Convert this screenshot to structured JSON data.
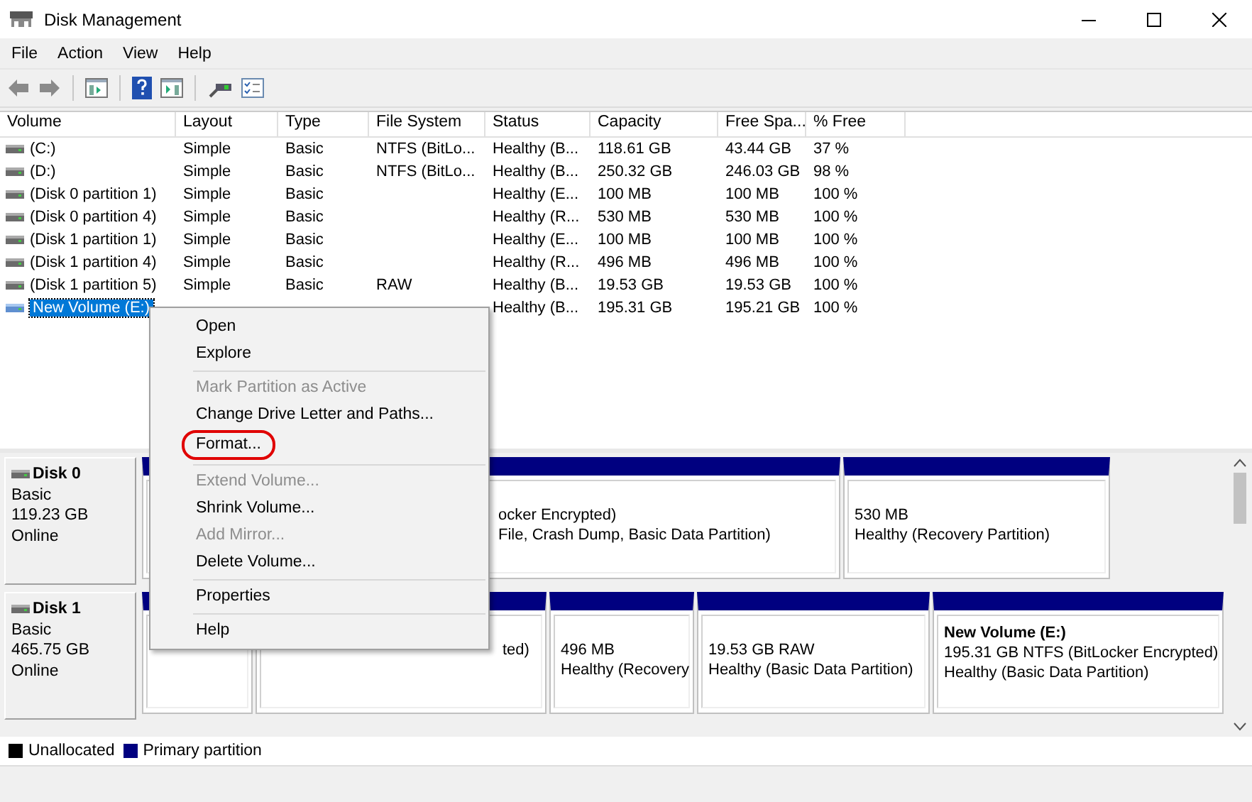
{
  "window": {
    "title": "Disk Management"
  },
  "menu_bar": [
    "File",
    "Action",
    "View",
    "Help"
  ],
  "table": {
    "columns": [
      "Volume",
      "Layout",
      "Type",
      "File System",
      "Status",
      "Capacity",
      "Free Spa...",
      "% Free"
    ],
    "rows": [
      {
        "cells": [
          "(C:)",
          "Simple",
          "Basic",
          "NTFS (BitLo...",
          "Healthy (B...",
          "118.61 GB",
          "43.44 GB",
          "37 %"
        ],
        "selected": false
      },
      {
        "cells": [
          "(D:)",
          "Simple",
          "Basic",
          "NTFS (BitLo...",
          "Healthy (B...",
          "250.32 GB",
          "246.03 GB",
          "98 %"
        ],
        "selected": false
      },
      {
        "cells": [
          "(Disk 0 partition 1)",
          "Simple",
          "Basic",
          "",
          "Healthy (E...",
          "100 MB",
          "100 MB",
          "100 %"
        ],
        "selected": false
      },
      {
        "cells": [
          "(Disk 0 partition 4)",
          "Simple",
          "Basic",
          "",
          "Healthy (R...",
          "530 MB",
          "530 MB",
          "100 %"
        ],
        "selected": false
      },
      {
        "cells": [
          "(Disk 1 partition 1)",
          "Simple",
          "Basic",
          "",
          "Healthy (E...",
          "100 MB",
          "100 MB",
          "100 %"
        ],
        "selected": false
      },
      {
        "cells": [
          "(Disk 1 partition 4)",
          "Simple",
          "Basic",
          "",
          "Healthy (R...",
          "496 MB",
          "496 MB",
          "100 %"
        ],
        "selected": false
      },
      {
        "cells": [
          "(Disk 1 partition 5)",
          "Simple",
          "Basic",
          "RAW",
          "Healthy (B...",
          "19.53 GB",
          "19.53 GB",
          "100 %"
        ],
        "selected": false
      },
      {
        "cells": [
          "New Volume (E:)",
          "",
          "",
          "",
          "Healthy (B...",
          "195.31 GB",
          "195.21 GB",
          "100 %"
        ],
        "selected": true
      }
    ]
  },
  "disks": [
    {
      "name": "Disk 0",
      "type": "Basic",
      "size": "119.23 GB",
      "status": "Online",
      "partitions": [
        {
          "kind": "hidden"
        },
        {
          "kind": "covered",
          "lines": [
            "ocker Encrypted)",
            "File, Crash Dump, Basic Data Partition)"
          ]
        },
        {
          "kind": "plain",
          "lines": [
            "530 MB",
            "Healthy (Recovery Partition)"
          ]
        }
      ]
    },
    {
      "name": "Disk 1",
      "type": "Basic",
      "size": "465.75 GB",
      "status": "Online",
      "partitions": [
        {
          "kind": "hidden"
        },
        {
          "kind": "covered",
          "lines": [
            "ted)"
          ]
        },
        {
          "kind": "plain",
          "lines": [
            "496 MB",
            "Healthy (Recovery"
          ]
        },
        {
          "kind": "plain",
          "lines": [
            "19.53 GB RAW",
            "Healthy (Basic Data Partition)"
          ]
        },
        {
          "kind": "titled",
          "title": "New Volume  (E:)",
          "lines": [
            "195.31 GB NTFS (BitLocker Encrypted)",
            "Healthy (Basic Data Partition)"
          ]
        }
      ]
    }
  ],
  "legend": [
    {
      "label": "Unallocated",
      "color": "#000000"
    },
    {
      "label": "Primary partition",
      "color": "#000080"
    }
  ],
  "context_menu": [
    {
      "kind": "item",
      "label": "Open",
      "disabled": false,
      "highlighted": false
    },
    {
      "kind": "item",
      "label": "Explore",
      "disabled": false,
      "highlighted": false
    },
    {
      "kind": "separator"
    },
    {
      "kind": "item",
      "label": "Mark Partition as Active",
      "disabled": true,
      "highlighted": false
    },
    {
      "kind": "item",
      "label": "Change Drive Letter and Paths...",
      "disabled": false,
      "highlighted": false
    },
    {
      "kind": "item",
      "label": "Format...",
      "disabled": false,
      "highlighted": true
    },
    {
      "kind": "separator"
    },
    {
      "kind": "item",
      "label": "Extend Volume...",
      "disabled": true,
      "highlighted": false
    },
    {
      "kind": "item",
      "label": "Shrink Volume...",
      "disabled": false,
      "highlighted": false
    },
    {
      "kind": "item",
      "label": "Add Mirror...",
      "disabled": true,
      "highlighted": false
    },
    {
      "kind": "item",
      "label": "Delete Volume...",
      "disabled": false,
      "highlighted": false
    },
    {
      "kind": "separator"
    },
    {
      "kind": "item",
      "label": "Properties",
      "disabled": false,
      "highlighted": false
    },
    {
      "kind": "separator"
    },
    {
      "kind": "item",
      "label": "Help",
      "disabled": false,
      "highlighted": false
    }
  ]
}
